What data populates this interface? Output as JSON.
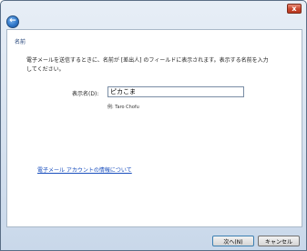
{
  "window": {
    "close_glyph": "x",
    "close_icon": "close-icon",
    "back_glyph": "←",
    "back_icon": "back-arrow-icon"
  },
  "page": {
    "heading": "名前",
    "description": "電子メールを送信するときに、名前が [差出人] のフィールドに表示されます。表示する名前を入力してください。",
    "display_name_label": "表示名(D):",
    "display_name_value": "ピカこま",
    "example": "例: Taro Chofu",
    "help_link": "電子メール アカウントの情報について"
  },
  "buttons": {
    "next": "次へ(N)",
    "cancel": "キャンセル"
  },
  "colors": {
    "accent": "#1a4fbe",
    "heading": "#1f3f75",
    "close": "#c8452b"
  }
}
